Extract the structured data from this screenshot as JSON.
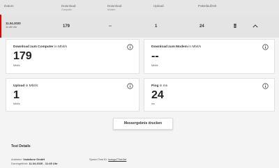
{
  "header": {
    "datum": "Datum",
    "download": "Download",
    "download_sub1": "Computer",
    "download2": "Download",
    "download_sub2": "Modem",
    "upload": "Upload",
    "paketlaufzeit": "Paketlaufzeit"
  },
  "row": {
    "date": "11.04.2020",
    "time": "11:45 Uhr",
    "download_computer": "179",
    "download_modem": "--",
    "upload": "1",
    "ping": "24"
  },
  "cards": {
    "dl_computer": {
      "title_bold": "Download zum Computer",
      "title_rest": " in Mbit/s",
      "value": "179",
      "unit": "Mbit/s"
    },
    "dl_modem": {
      "title_bold": "Download zum Modem",
      "title_rest": " in Mbit/s",
      "value": "--",
      "unit": "Mbit/s"
    },
    "upload": {
      "title_bold": "Upload",
      "title_rest": " in Mbit/s",
      "value": "1",
      "unit": "Mbit/s"
    },
    "ping": {
      "title_bold": "Ping",
      "title_rest": " in ms",
      "value": "24",
      "unit": "ms"
    }
  },
  "print_button": "Messergebnis drucken",
  "details": {
    "heading": "Test Details",
    "anbieter_label": "Anbieter:",
    "anbieter_value": "Vodafone GmbH",
    "durchgefuehrt_label": "Durchgeführt:",
    "durchgefuehrt_value": "11.04.2020 - 11:45 Uhr",
    "speedtest_label": "Speed Test ID:",
    "speedtest_value": "tzzvgc77mr2m"
  },
  "colors": {
    "accent": "#e60000",
    "header_bg": "#e6e6e6",
    "row_bg": "#e4e4e4",
    "page_bg": "#f4f4f4"
  },
  "icons": {
    "delete": "trash-icon",
    "collapse": "chevron-up-icon",
    "info": "info-icon"
  }
}
